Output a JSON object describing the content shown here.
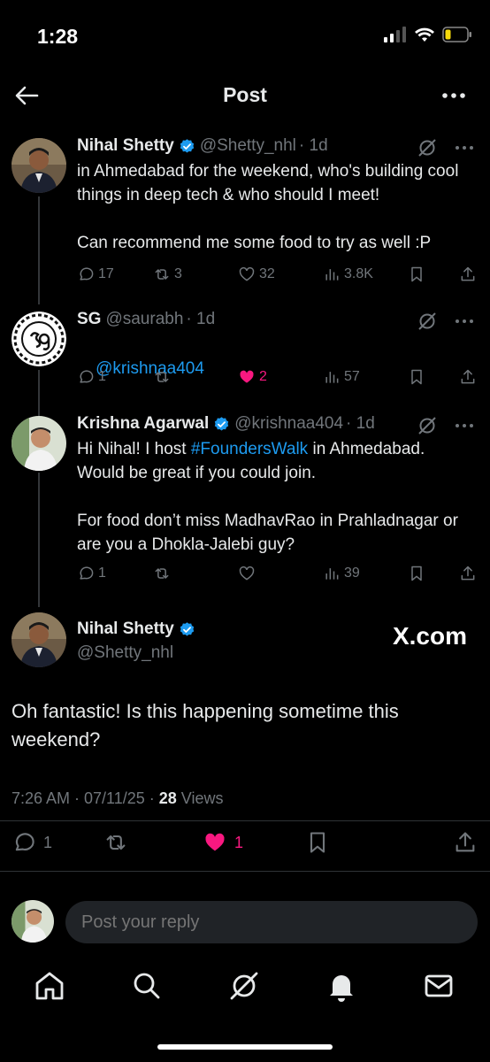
{
  "status": {
    "time": "1:28"
  },
  "header": {
    "title": "Post"
  },
  "thread": [
    {
      "name": "Nihal Shetty",
      "handle": "@Shetty_nhl",
      "age": "· 1d",
      "text": "in Ahmedabad for the weekend, who's building cool things in deep tech & who should I meet!\n\nCan recommend me some food to try as well :P",
      "replies": "17",
      "reposts": "3",
      "likes": "32",
      "views": "3.8K"
    },
    {
      "name": "SG",
      "handle": "@saurabh",
      "age": "· 1d",
      "mention": "@krishnaa404",
      "replies": "1",
      "reposts": "",
      "likes": "2",
      "views": "57"
    },
    {
      "name": "Krishna Agarwal",
      "handle": "@krishnaa404",
      "age": "· 1d",
      "text_a": "Hi Nihal! I host ",
      "hashtag": "#FoundersWalk",
      "text_b": " in Ahmedabad. Would be great if you could join.\n\nFor food don’t miss MadhavRao in Prahladnagar or are you a Dhokla-Jalebi guy?",
      "replies": "1",
      "reposts": "",
      "likes": "",
      "views": "39"
    }
  ],
  "main": {
    "name": "Nihal Shetty",
    "handle": "@Shetty_nhl",
    "watermark": "X.com",
    "text": "Oh fantastic! Is this happening sometime this weekend?",
    "meta": "7:26 AM · 07/11/25 · ",
    "views_count": "28",
    "views_label": " Views",
    "replies": "1",
    "likes": "1"
  },
  "reply": {
    "placeholder": "Post your reply"
  },
  "colors": {
    "accent": "#1d9bf0",
    "like": "#f91880",
    "muted": "#71767b"
  },
  "icons": [
    "back-icon",
    "more-icon",
    "verified-icon",
    "grok-icon",
    "reply-icon",
    "repost-icon",
    "like-icon",
    "views-icon",
    "bookmark-icon",
    "share-icon",
    "home-icon",
    "search-icon",
    "notifications-icon",
    "messages-icon"
  ]
}
